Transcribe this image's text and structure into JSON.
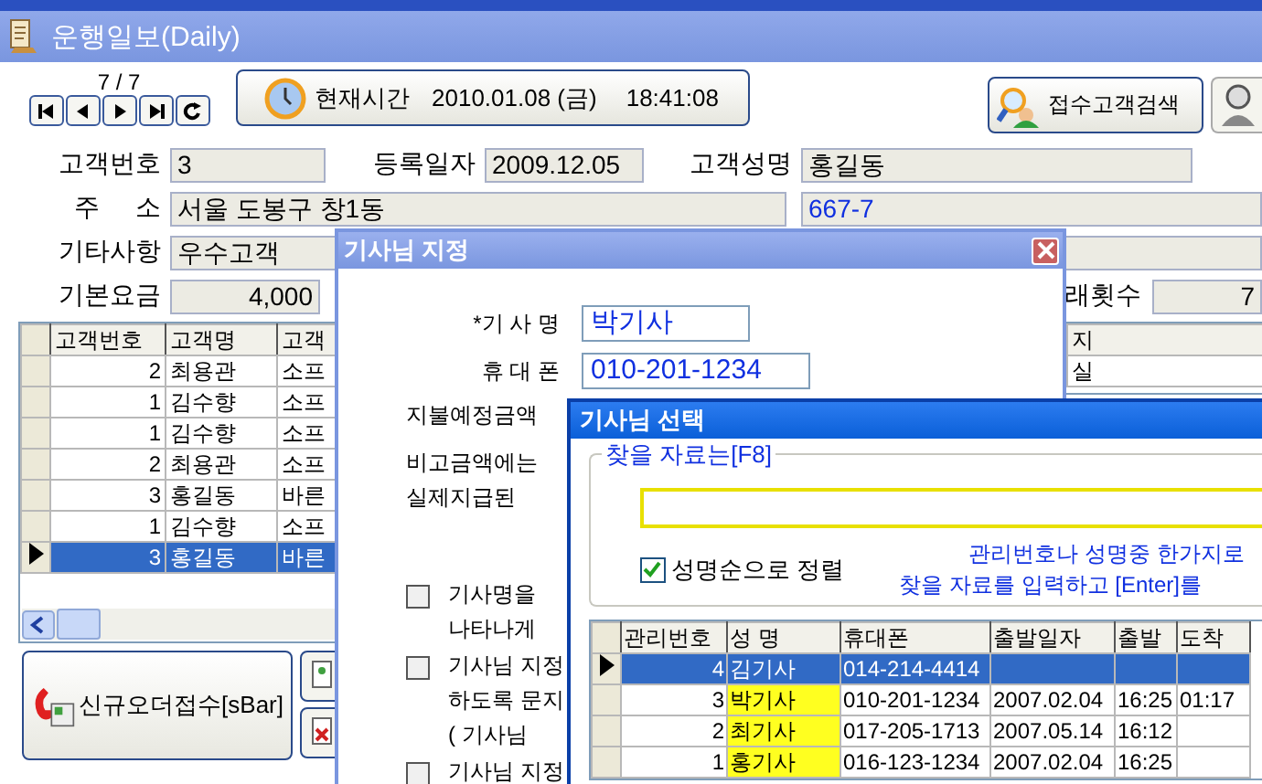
{
  "main_window": {
    "title": "운행일보(Daily)",
    "record_counter": "7 / 7",
    "nav_buttons": [
      {
        "kind": "first"
      },
      {
        "kind": "prev"
      },
      {
        "kind": "next"
      },
      {
        "kind": "last"
      },
      {
        "kind": "refresh"
      }
    ],
    "clock_button": {
      "label": "현재시간",
      "date": "2010.01.08 (금)",
      "time": "18:41:08"
    },
    "search_button": {
      "label": "접수고객검색"
    },
    "customer": {
      "number_label": "고객번호",
      "number": "3",
      "reg_date_label": "등록일자",
      "reg_date": "2009.12.05",
      "name_label": "고객성명",
      "name": "홍길동",
      "address_label": "주     소",
      "address": "서울 도봉구 창1동",
      "address_detail": "667-7",
      "note_label": "기타사항",
      "note": "우수고객",
      "base_fee_label": "기본요금",
      "base_fee": "4,000",
      "count_label": "래횟수",
      "count": "7"
    },
    "customer_grid": {
      "columns": [
        "고객번호",
        "고객명",
        "고객"
      ],
      "rows": [
        {
          "cells": [
            "2",
            "최용관",
            "소프"
          ],
          "selected": false
        },
        {
          "cells": [
            "1",
            "김수향",
            "소프"
          ],
          "selected": false
        },
        {
          "cells": [
            "1",
            "김수향",
            "소프"
          ],
          "selected": false
        },
        {
          "cells": [
            "2",
            "최용관",
            "소프"
          ],
          "selected": false
        },
        {
          "cells": [
            "3",
            "홍길동",
            "바른"
          ],
          "selected": false
        },
        {
          "cells": [
            "1",
            "김수향",
            "소프"
          ],
          "selected": false
        },
        {
          "cells": [
            "3",
            "홍길동",
            "바른"
          ],
          "selected": true
        }
      ]
    },
    "side_grid": {
      "columns": [
        "지"
      ],
      "rows": [
        {
          "cells": [
            "실"
          ]
        }
      ]
    },
    "new_order_button": {
      "label": "신규오더접수[sBar]"
    }
  },
  "assign_dialog": {
    "title": "기사님 지정",
    "driver_label": "*기 사 명",
    "driver": "박기사",
    "phone_label": "휴 대 폰",
    "phone": "010-201-1234",
    "amount_label": "지불예정금액",
    "notes": [
      "비고금액에는",
      "실제지급된"
    ],
    "options": [
      {
        "lines": [
          "기사명을",
          "나타나게"
        ],
        "checked": false
      },
      {
        "lines": [
          "기사님 지정",
          "하도록 문지",
          "( 기사님"
        ],
        "checked": false
      },
      {
        "lines": [
          "기사님 지정"
        ],
        "checked": false
      }
    ]
  },
  "select_dialog": {
    "title": "기사님 선택",
    "group_label": "찾을 자료는[F8]",
    "hints": [
      "관리번호나 성명중 한가지로",
      "찾을 자료를 입력하고 [Enter]를"
    ],
    "sort_option": {
      "label": "성명순으로 정렬",
      "checked": true
    },
    "grid": {
      "columns": [
        "관리번호",
        "성   명",
        "휴대폰",
        "출발일자",
        "출발",
        "도착"
      ],
      "rows": [
        {
          "cells": [
            "4",
            "김기사",
            "014-214-4414"
          ],
          "selected": true
        },
        {
          "cells": [
            "3",
            "박기사",
            "010-201-1234",
            "2007.02.04",
            "16:25",
            "01:17"
          ],
          "selected": false
        },
        {
          "cells": [
            "2",
            "최기사",
            "017-205-1713",
            "2007.05.14",
            "16:12"
          ],
          "selected": false
        },
        {
          "cells": [
            "1",
            "홍기사",
            "016-123-1234",
            "2007.02.04",
            "16:25"
          ],
          "selected": false
        }
      ]
    }
  }
}
